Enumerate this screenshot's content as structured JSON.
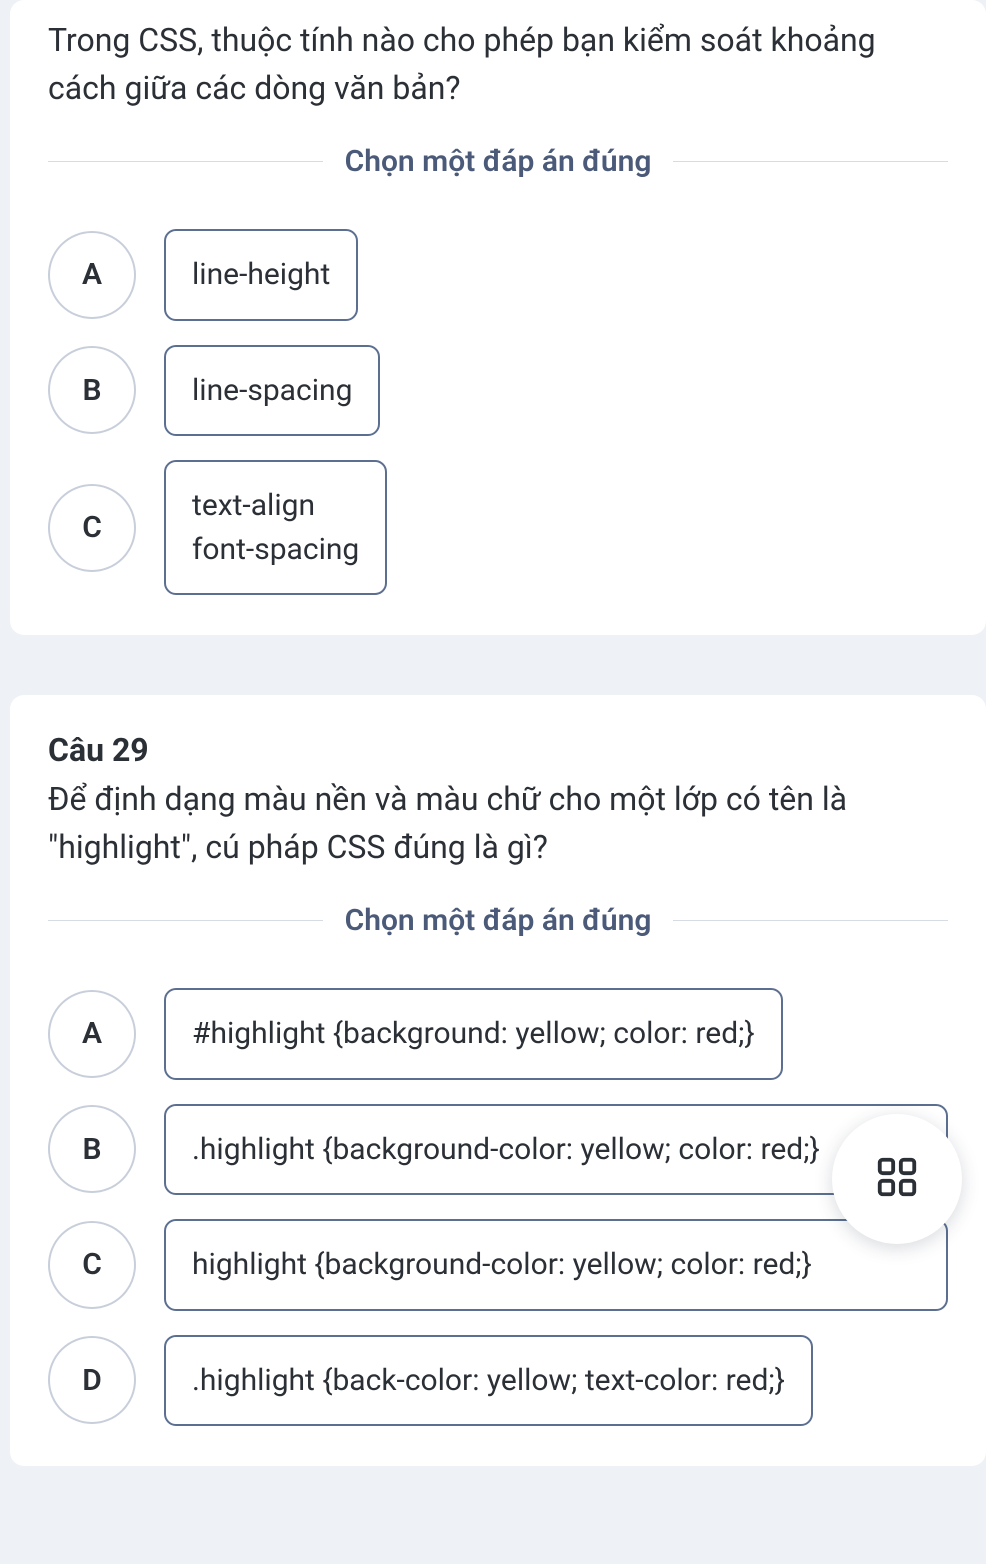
{
  "q28": {
    "text": "Trong CSS, thuộc tính nào cho phép bạn kiểm soát khoảng cách giữa các dòng văn bản?",
    "instruction": "Chọn một đáp án đúng",
    "options": [
      {
        "letter": "A",
        "text": "line-height"
      },
      {
        "letter": "B",
        "text": "line-spacing"
      },
      {
        "letter": "C",
        "text": "text-align\nfont-spacing"
      }
    ]
  },
  "q29": {
    "number": "Câu 29",
    "text": "Để định dạng màu nền và màu chữ cho một lớp có tên là \"highlight\", cú pháp CSS đúng là gì?",
    "instruction": "Chọn một đáp án đúng",
    "options": [
      {
        "letter": "A",
        "text": "#highlight {background: yellow; color: red;}"
      },
      {
        "letter": "B",
        "text": ".highlight {background-color: yellow; color: red;}"
      },
      {
        "letter": "C",
        "text": "highlight {background-color: yellow; color: red;}"
      },
      {
        "letter": "D",
        "text": ".highlight {back-color: yellow; text-color: red;}"
      }
    ]
  }
}
